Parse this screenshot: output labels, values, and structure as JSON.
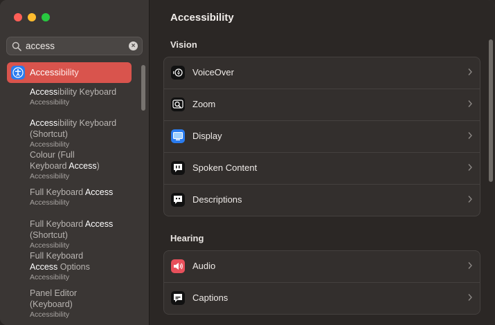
{
  "search": {
    "value": "access"
  },
  "sidebar": {
    "selected": {
      "prefix": "Access",
      "suffix": "ibility"
    },
    "results": [
      {
        "lines": [
          [
            "Access",
            "ibility Keyboard"
          ]
        ],
        "sub": "Accessibility"
      },
      {
        "lines": [
          [
            "Access",
            "ibility Keyboard"
          ],
          [
            "",
            "(Shortcut)"
          ]
        ],
        "sub": "Accessibility"
      },
      {
        "lines": [
          [
            "",
            "Colour (Full"
          ],
          [
            "",
            "Keyboard ",
            "Access",
            ")"
          ]
        ],
        "sub": "Accessibility"
      },
      {
        "lines": [
          [
            "",
            "Full Keyboard ",
            "Access"
          ]
        ],
        "sub": "Accessibility"
      },
      {
        "lines": [
          [
            "",
            "Full Keyboard ",
            "Access"
          ],
          [
            "",
            "(Shortcut)"
          ]
        ],
        "sub": "Accessibility"
      },
      {
        "lines": [
          [
            "",
            "Full Keyboard"
          ],
          [
            "Access",
            " Options"
          ]
        ],
        "sub": "Accessibility"
      },
      {
        "lines": [
          [
            "",
            "Panel Editor"
          ],
          [
            "",
            "(Keyboard)"
          ]
        ],
        "sub": "Accessibility"
      }
    ]
  },
  "main": {
    "title": "Accessibility",
    "vision": {
      "title": "Vision",
      "items": [
        {
          "label": "VoiceOver",
          "icon": "voiceover-icon"
        },
        {
          "label": "Zoom",
          "icon": "zoom-icon"
        },
        {
          "label": "Display",
          "icon": "display-icon"
        },
        {
          "label": "Spoken Content",
          "icon": "spoken-content-icon"
        },
        {
          "label": "Descriptions",
          "icon": "descriptions-icon"
        }
      ]
    },
    "hearing": {
      "title": "Hearing",
      "items": [
        {
          "label": "Audio",
          "icon": "audio-icon"
        },
        {
          "label": "Captions",
          "icon": "captions-icon"
        }
      ]
    }
  },
  "colors": {
    "selection": "#d9544d",
    "accessibility_icon": "#2a7cf0",
    "display_icon": "#2a7cf0",
    "audio_icon": "#e8505b"
  }
}
